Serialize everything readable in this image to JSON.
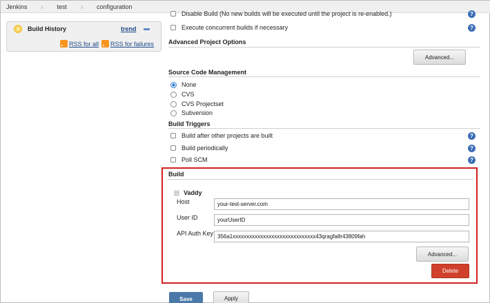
{
  "breadcrumbs": [
    "Jenkins",
    "test",
    "configuration"
  ],
  "sidebar": {
    "build_history": "Build History",
    "trend": "trend",
    "rss_all": "RSS for all",
    "rss_failures": "RSS for failures"
  },
  "options": {
    "disable_build": "Disable Build (No new builds will be executed until the project is re-enabled.)",
    "concurrent": "Execute concurrent builds if necessary",
    "advanced_title": "Advanced Project Options",
    "advanced_button": "Advanced..."
  },
  "scm": {
    "title": "Source Code Management",
    "items": [
      "None",
      "CVS",
      "CVS Projectset",
      "Subversion"
    ],
    "selected": "None"
  },
  "triggers": {
    "title": "Build Triggers",
    "items": [
      "Build after other projects are built",
      "Build periodically",
      "Poll SCM"
    ]
  },
  "build": {
    "title": "Build",
    "step_name": "Vaddy",
    "host_label": "Host",
    "host_value": "your-test-server.com",
    "user_label": "User ID",
    "user_value": "yourUserID",
    "key_label": "API Auth Key",
    "key_value": "356a1xxxxxxxxxxxxxxxxxxxxxxxxxxxxxx43qragfa8r43809fah",
    "advanced_button": "Advanced...",
    "delete_button": "Delete"
  },
  "footer": {
    "save": "Save",
    "apply": "Apply"
  },
  "help_glyph": "?",
  "colors": {
    "highlight_border": "#d21f1f",
    "delete_button": "#d0402b",
    "save_button": "#4a78a8",
    "help_icon": "#3b6cb5",
    "radio_selected": "#2d7dd2"
  }
}
